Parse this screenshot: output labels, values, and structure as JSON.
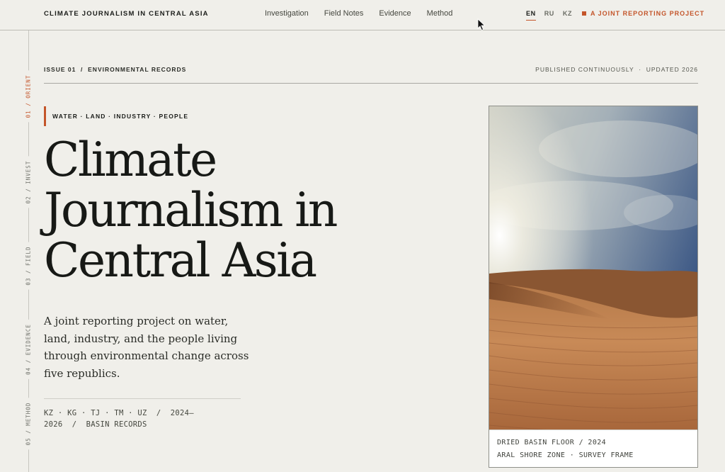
{
  "header": {
    "brand": "CLIMATE JOURNALISM IN CENTRAL ASIA",
    "nav": [
      "Investigation",
      "Field Notes",
      "Evidence",
      "Method"
    ],
    "languages": [
      "EN",
      "RU",
      "KZ"
    ],
    "active_language": "EN",
    "project_label": "A JOINT REPORTING PROJECT"
  },
  "rail": {
    "sections": [
      "01 / ORIENT",
      "02 / INVEST",
      "03 / FIELD",
      "04 / EVIDENCE",
      "05 / METHOD"
    ],
    "active_index": 0
  },
  "issue": {
    "label": "ISSUE 01  /  ENVIRONMENTAL RECORDS",
    "published": "PUBLISHED CONTINUOUSLY  ·  UPDATED 2026"
  },
  "hero": {
    "kicker": "WATER · LAND · INDUSTRY · PEOPLE",
    "headline_lines": [
      "Climate",
      "Journalism in",
      "Central Asia"
    ],
    "lede": "A joint reporting project on water, land, industry, and the people living through environmental change across five republics.",
    "meta": "KZ · KG · TJ · TM · UZ  /  2024–2026  /  BASIN RECORDS"
  },
  "figure": {
    "caption_line1": "DRIED BASIN FLOOR / 2024",
    "caption_line2": "ARAL SHORE ZONE · SURVEY FRAME"
  },
  "colors": {
    "accent": "#c4552a",
    "background": "#f0efea",
    "ink": "#1b1d1a"
  },
  "icons": {
    "cursor": "mouse-pointer-icon",
    "project_marker": "square-marker-icon"
  }
}
